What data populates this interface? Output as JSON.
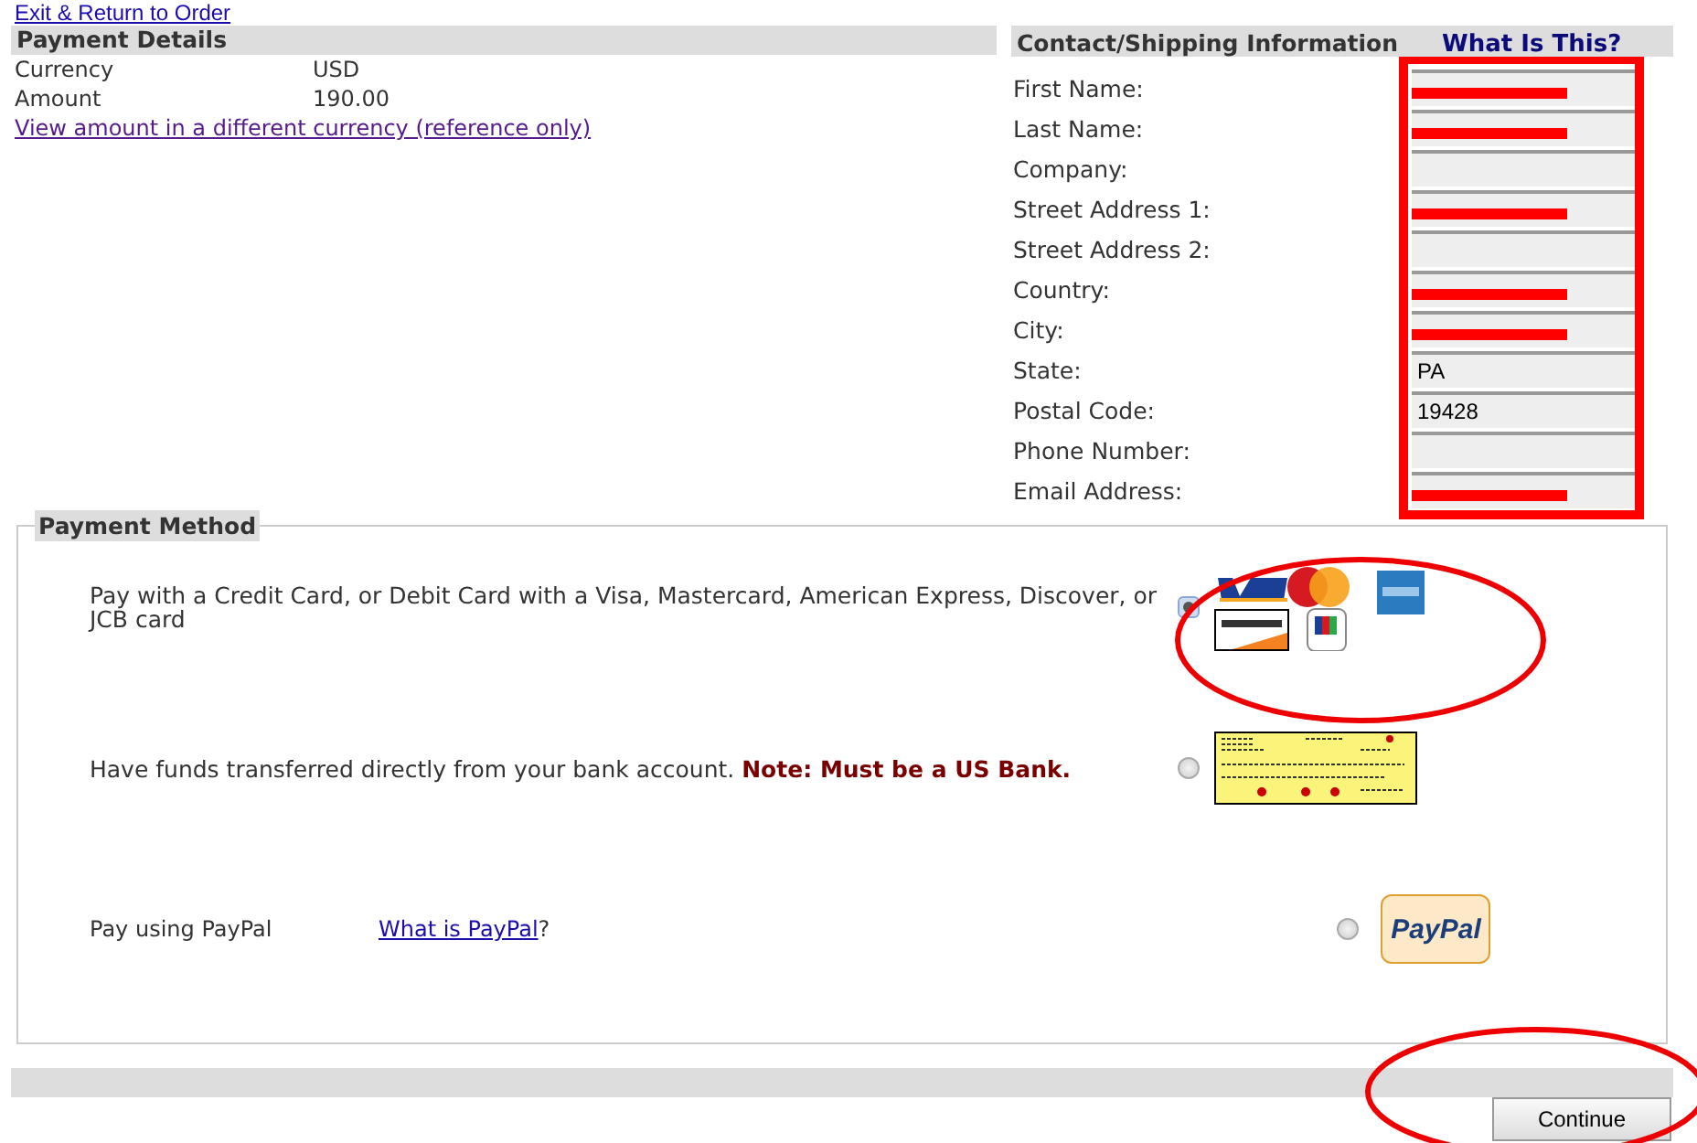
{
  "top_link": "Exit & Return to Order",
  "payment_details": {
    "title": "Payment Details",
    "rows": [
      {
        "label": "Currency",
        "value": "USD"
      },
      {
        "label": "Amount",
        "value": "190.00"
      }
    ],
    "link": "View amount in a different currency (reference only)"
  },
  "contact": {
    "title": "Contact/Shipping Information",
    "help_link": "What Is This?",
    "fields": [
      {
        "label": "First Name:",
        "redacted": true
      },
      {
        "label": "Last Name:",
        "redacted": true
      },
      {
        "label": "Company:",
        "redacted": false
      },
      {
        "label": "Street Address 1:",
        "redacted": true
      },
      {
        "label": "Street Address 2:",
        "redacted": false
      },
      {
        "label": "Country:",
        "redacted": true
      },
      {
        "label": "City:",
        "redacted": true
      },
      {
        "label": "State:",
        "value": "PA",
        "redacted": false
      },
      {
        "label": "Postal Code:",
        "value": "19428",
        "redacted": false
      },
      {
        "label": "Phone Number:",
        "redacted": false
      },
      {
        "label": "Email Address:",
        "redacted": true
      }
    ]
  },
  "payment_method": {
    "title": "Payment Method",
    "options": [
      {
        "kind": "card",
        "text": "Pay with a Credit Card, or Debit Card with a Visa, Mastercard, American Express, Discover, or JCB card",
        "selected": true
      },
      {
        "kind": "bank",
        "text": "Have funds transferred directly from your bank account. **Note: Must be a US Bank.**",
        "selected": false
      },
      {
        "kind": "paypal",
        "text": "Pay using PayPal",
        "link": "What is PayPal",
        "link_suffix": "?",
        "badge": "PayPal",
        "selected": false
      }
    ]
  },
  "continue_button": "Continue"
}
